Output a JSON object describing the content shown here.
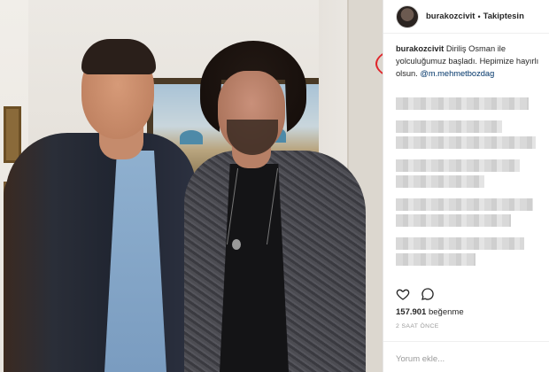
{
  "post": {
    "username": "burakozcivit",
    "dot": "•",
    "follow_status": "Takiptesin"
  },
  "caption": {
    "username": "burakozcivit",
    "text": "Diriliş Osman ile yolculuğumuz başladı. Hepimize hayırlı olsun.",
    "mention": "@m.mehmetbozdag"
  },
  "engagement": {
    "likes_count": "157.901",
    "likes_label": "beğenme",
    "time_ago": "2 SAAT ÖNCE"
  },
  "comment": {
    "placeholder": "Yorum ekle..."
  },
  "icons": {
    "like": "heart-icon",
    "comment": "comment-icon",
    "options": "more-options-icon"
  },
  "colors": {
    "highlight_ellipse": "#e0242a",
    "mention": "#003569"
  }
}
